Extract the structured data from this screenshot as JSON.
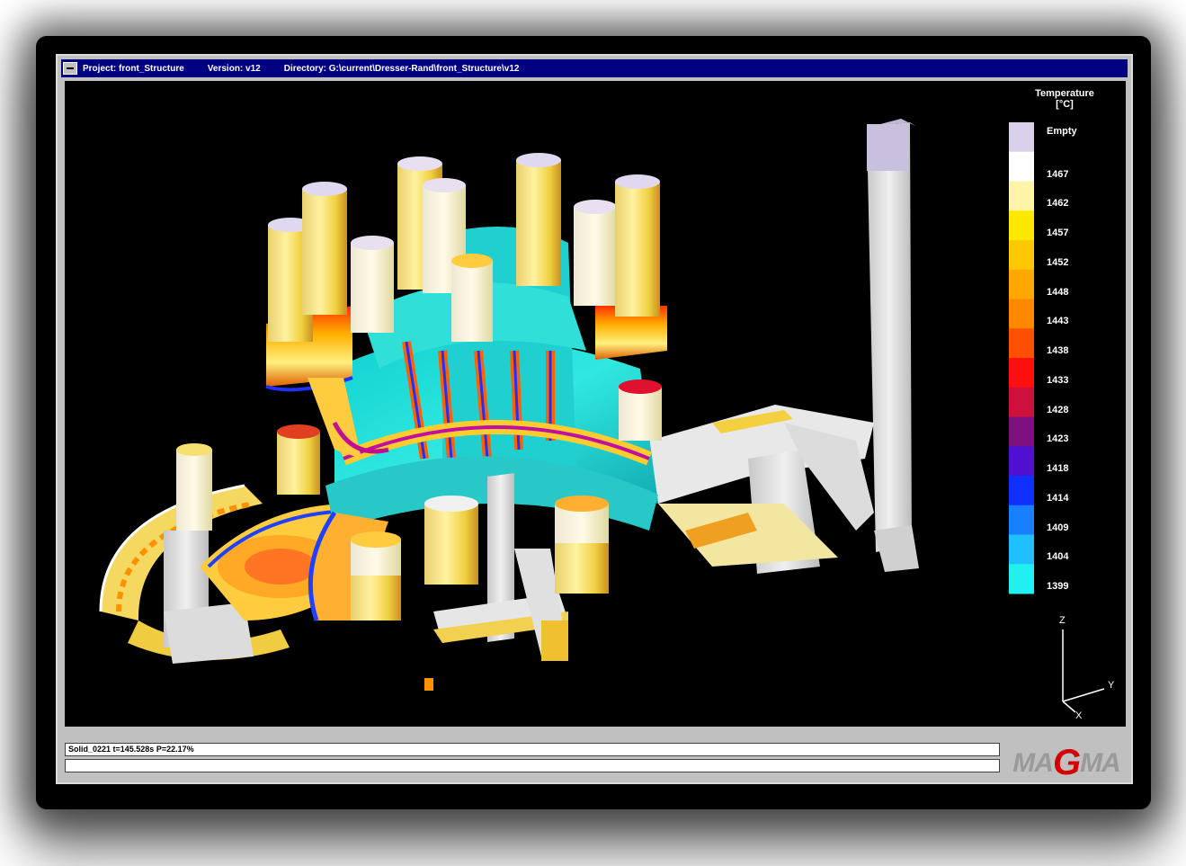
{
  "titlebar": {
    "project": "Project: front_Structure",
    "version": "Version: v12",
    "directory": "Directory: G:\\current\\Dresser-Rand\\front_Structure\\v12"
  },
  "legend": {
    "title_line1": "Temperature",
    "title_line2": "[°C]",
    "entries": [
      {
        "label": "Empty",
        "color": "#d8d0e8"
      },
      {
        "label": "1467",
        "color": "#ffffff"
      },
      {
        "label": "1462",
        "color": "#fff4a8"
      },
      {
        "label": "1457",
        "color": "#ffe800"
      },
      {
        "label": "1452",
        "color": "#ffc800"
      },
      {
        "label": "1448",
        "color": "#ffa800"
      },
      {
        "label": "1443",
        "color": "#ff8800"
      },
      {
        "label": "1438",
        "color": "#ff5000"
      },
      {
        "label": "1433",
        "color": "#ff1010"
      },
      {
        "label": "1428",
        "color": "#d0103c"
      },
      {
        "label": "1423",
        "color": "#801080"
      },
      {
        "label": "1418",
        "color": "#5010d0"
      },
      {
        "label": "1414",
        "color": "#1030ff"
      },
      {
        "label": "1409",
        "color": "#1880ff"
      },
      {
        "label": "1404",
        "color": "#20c0ff"
      },
      {
        "label": "1399",
        "color": "#20f0f0"
      }
    ]
  },
  "axes": {
    "z": "Z",
    "y": "Y",
    "x": "X"
  },
  "status": {
    "line1": "Solid_0221 t=145.528s P=22.17%",
    "line2": ""
  },
  "logo": {
    "pre": "MA",
    "g": "G",
    "post": "MA"
  },
  "colors": {
    "titlebar": "#000080",
    "cyan": "#20d8d8",
    "yellow": "#f0e070",
    "grey": "#d8d8d8"
  }
}
